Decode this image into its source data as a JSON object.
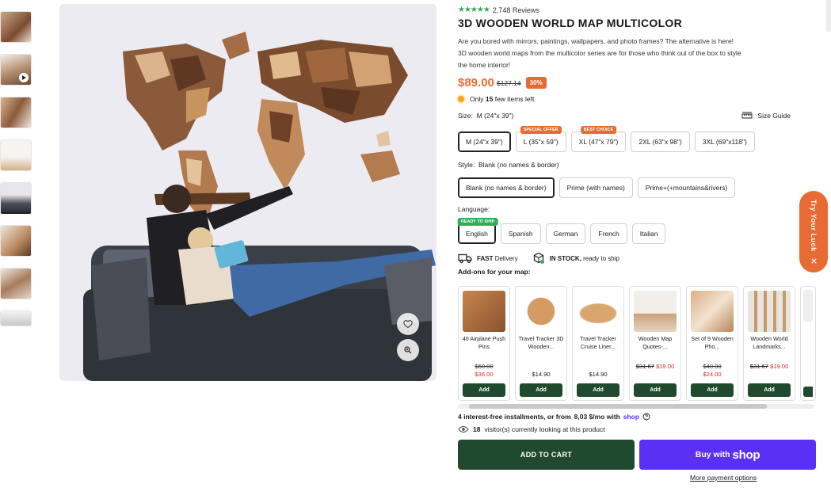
{
  "product": {
    "title": "3D WOODEN WORLD MAP MULTICOLOR",
    "reviews": "2,748 Reviews",
    "stars": "★★★★★",
    "description": "Are you bored with mirrors, paintings, wallpapers, and photo frames? The alternative is here! 3D wooden world maps from the multicolor series are for those who think out of the box to style the home interior!",
    "price": "$89.00",
    "old_price": "$127.14",
    "discount": "30%",
    "stock_prefix": "Only",
    "stock_count": "15",
    "stock_suffix": "few items left"
  },
  "size": {
    "label": "Size:",
    "value": "M (24\"x 39\")",
    "guide": "Size Guide",
    "options": [
      {
        "label": "M (24\"x 39\")",
        "tag": ""
      },
      {
        "label": "L (35\"x 59\")",
        "tag": "SPECIAL OFFER"
      },
      {
        "label": "XL (47\"x 79\")",
        "tag": "BEST CHOICE"
      },
      {
        "label": "2XL (63\"x 98\")",
        "tag": ""
      },
      {
        "label": "3XL (69\"x118\")",
        "tag": ""
      }
    ]
  },
  "style": {
    "label": "Style:",
    "value": "Blank (no names & border)",
    "options": [
      "Blank (no names & border)",
      "Prime (with names)",
      "Prime+(+mountains&rivers)"
    ]
  },
  "language": {
    "label": "Language:",
    "tag": "READY TO SHIP",
    "options": [
      "English",
      "Spanish",
      "German",
      "French",
      "Italian"
    ]
  },
  "features": {
    "delivery_bold": "FAST",
    "delivery_text": "Delivery",
    "stock_bold": "IN STOCK,",
    "stock_text": "ready to ship"
  },
  "addons": {
    "title": "Add-ons for your map:",
    "add_label": "Add",
    "items": [
      {
        "name": "40 Airplane Push Pins",
        "old": "$60.00",
        "price": "$36.00"
      },
      {
        "name": "Travel Tracker 3D Wooden...",
        "old": "",
        "price": "$14.90"
      },
      {
        "name": "Travel Tracker Cruise Liner...",
        "old": "",
        "price": "$14.90"
      },
      {
        "name": "Wooden Map Quotes-...",
        "old": "$31.67",
        "price": "$19.00"
      },
      {
        "name": "Set of 9 Wooden Pho...",
        "old": "$40.00",
        "price": "$24.00"
      },
      {
        "name": "Wooden World Landmarks...",
        "old": "$31.67",
        "price": "$19.00"
      }
    ]
  },
  "installments": {
    "prefix": "4 interest-free installments, or from",
    "amount": "8,03 $/mo with",
    "brand": "shop"
  },
  "visitors": {
    "count": "18",
    "text": "visitor(s) currently looking at this product"
  },
  "buttons": {
    "add_to_cart": "ADD TO CART",
    "buy_with": "Buy with",
    "buy_brand": "shop",
    "more_options": "More payment options"
  },
  "side": {
    "try_luck": "Try Your Luck"
  },
  "colors": {
    "accent": "#e86b34",
    "dark_green": "#1f4a2e",
    "shop_purple": "#5a31f4",
    "star_green": "#3aa757"
  }
}
